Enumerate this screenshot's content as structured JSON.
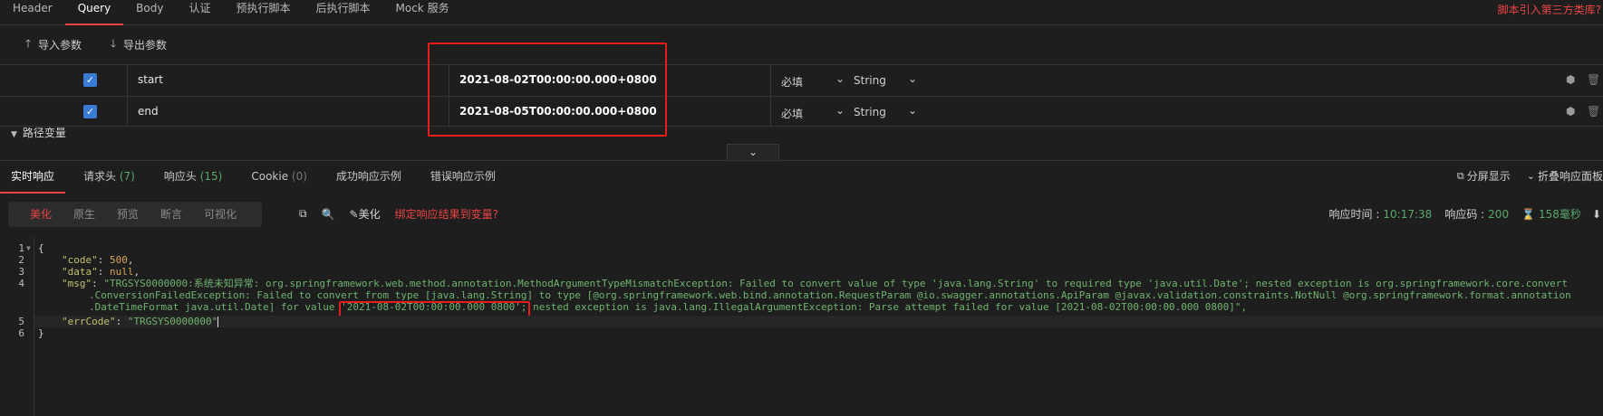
{
  "top_tabs": [
    {
      "label": "Header",
      "active": false
    },
    {
      "label": "Query",
      "active": true
    },
    {
      "label": "Body",
      "active": false
    },
    {
      "label": "认证",
      "active": false
    },
    {
      "label": "预执行脚本",
      "active": false
    },
    {
      "label": "后执行脚本",
      "active": false
    },
    {
      "label": "Mock 服务",
      "active": false
    }
  ],
  "top_right_link": "脚本引入第三方类库?",
  "io": {
    "import_label": "导入参数",
    "export_label": "导出参数"
  },
  "params": [
    {
      "key": "start",
      "value": "2021-08-02T00:00:00.000+0800",
      "required": "必填",
      "type": "String"
    },
    {
      "key": "end",
      "value": "2021-08-05T00:00:00.000+0800",
      "required": "必填",
      "type": "String"
    }
  ],
  "path_var_label": "路径变量",
  "response_tabs": [
    {
      "label": "实时响应",
      "count": "",
      "active": true
    },
    {
      "label": "请求头",
      "count": "(7)",
      "active": false
    },
    {
      "label": "响应头",
      "count": "(15)",
      "active": false
    },
    {
      "label": "Cookie",
      "count": "(0)",
      "active": false
    },
    {
      "label": "成功响应示例",
      "count": "",
      "active": false
    },
    {
      "label": "错误响应示例",
      "count": "",
      "active": false
    }
  ],
  "response_right": {
    "fullscreen_label": "分屏显示",
    "collapse_label": "折叠响应面板"
  },
  "view_modes": [
    {
      "label": "美化",
      "active": true
    },
    {
      "label": "原生",
      "active": false
    },
    {
      "label": "预览",
      "active": false
    },
    {
      "label": "断言",
      "active": false
    },
    {
      "label": "可视化",
      "active": false
    }
  ],
  "toolbar": {
    "beautify_label": "美化",
    "bind_label": "绑定响应结果到变量?"
  },
  "response_meta": {
    "time_label": "响应时间 :",
    "time_value": "10:17:38",
    "code_label": "响应码 :",
    "code_value": "200",
    "duration_value": "158毫秒"
  },
  "code_lines": [
    {
      "num": "1",
      "fold": true
    },
    {
      "num": "2"
    },
    {
      "num": "3"
    },
    {
      "num": "4"
    },
    {
      "num": "5"
    },
    {
      "num": "6",
      "fold": false
    }
  ],
  "json_body": {
    "open": "{",
    "close": "}",
    "code_key": "\"code\"",
    "code_val": "500",
    "data_key": "\"data\"",
    "data_val": "null",
    "msg_key": "\"msg\"",
    "msg_line1": "\"TRGSYS0000000:系统未知异常: org.springframework.web.method.annotation.MethodArgumentTypeMismatchException: Failed to convert value of type 'java.lang.String' to required type 'java.util.Date'; nested exception is org.springframework.core.convert",
    "msg_line2": ".ConversionFailedException: Failed to convert from type [java.lang.String] to type [@org.springframework.web.bind.annotation.RequestParam @io.swagger.annotations.ApiParam @javax.validation.constraints.NotNull @org.springframework.format.annotation",
    "msg_line3": ".DateTimeFormat java.util.Date] for value '2021-08-02T00:00:00.000 0800'; nested exception is java.lang.IllegalArgumentException: Parse attempt failed for value [2021-08-02T00:00:00.000 0800]\",",
    "err_key": "\"errCode\"",
    "err_val": "\"TRGSYS0000000\""
  }
}
